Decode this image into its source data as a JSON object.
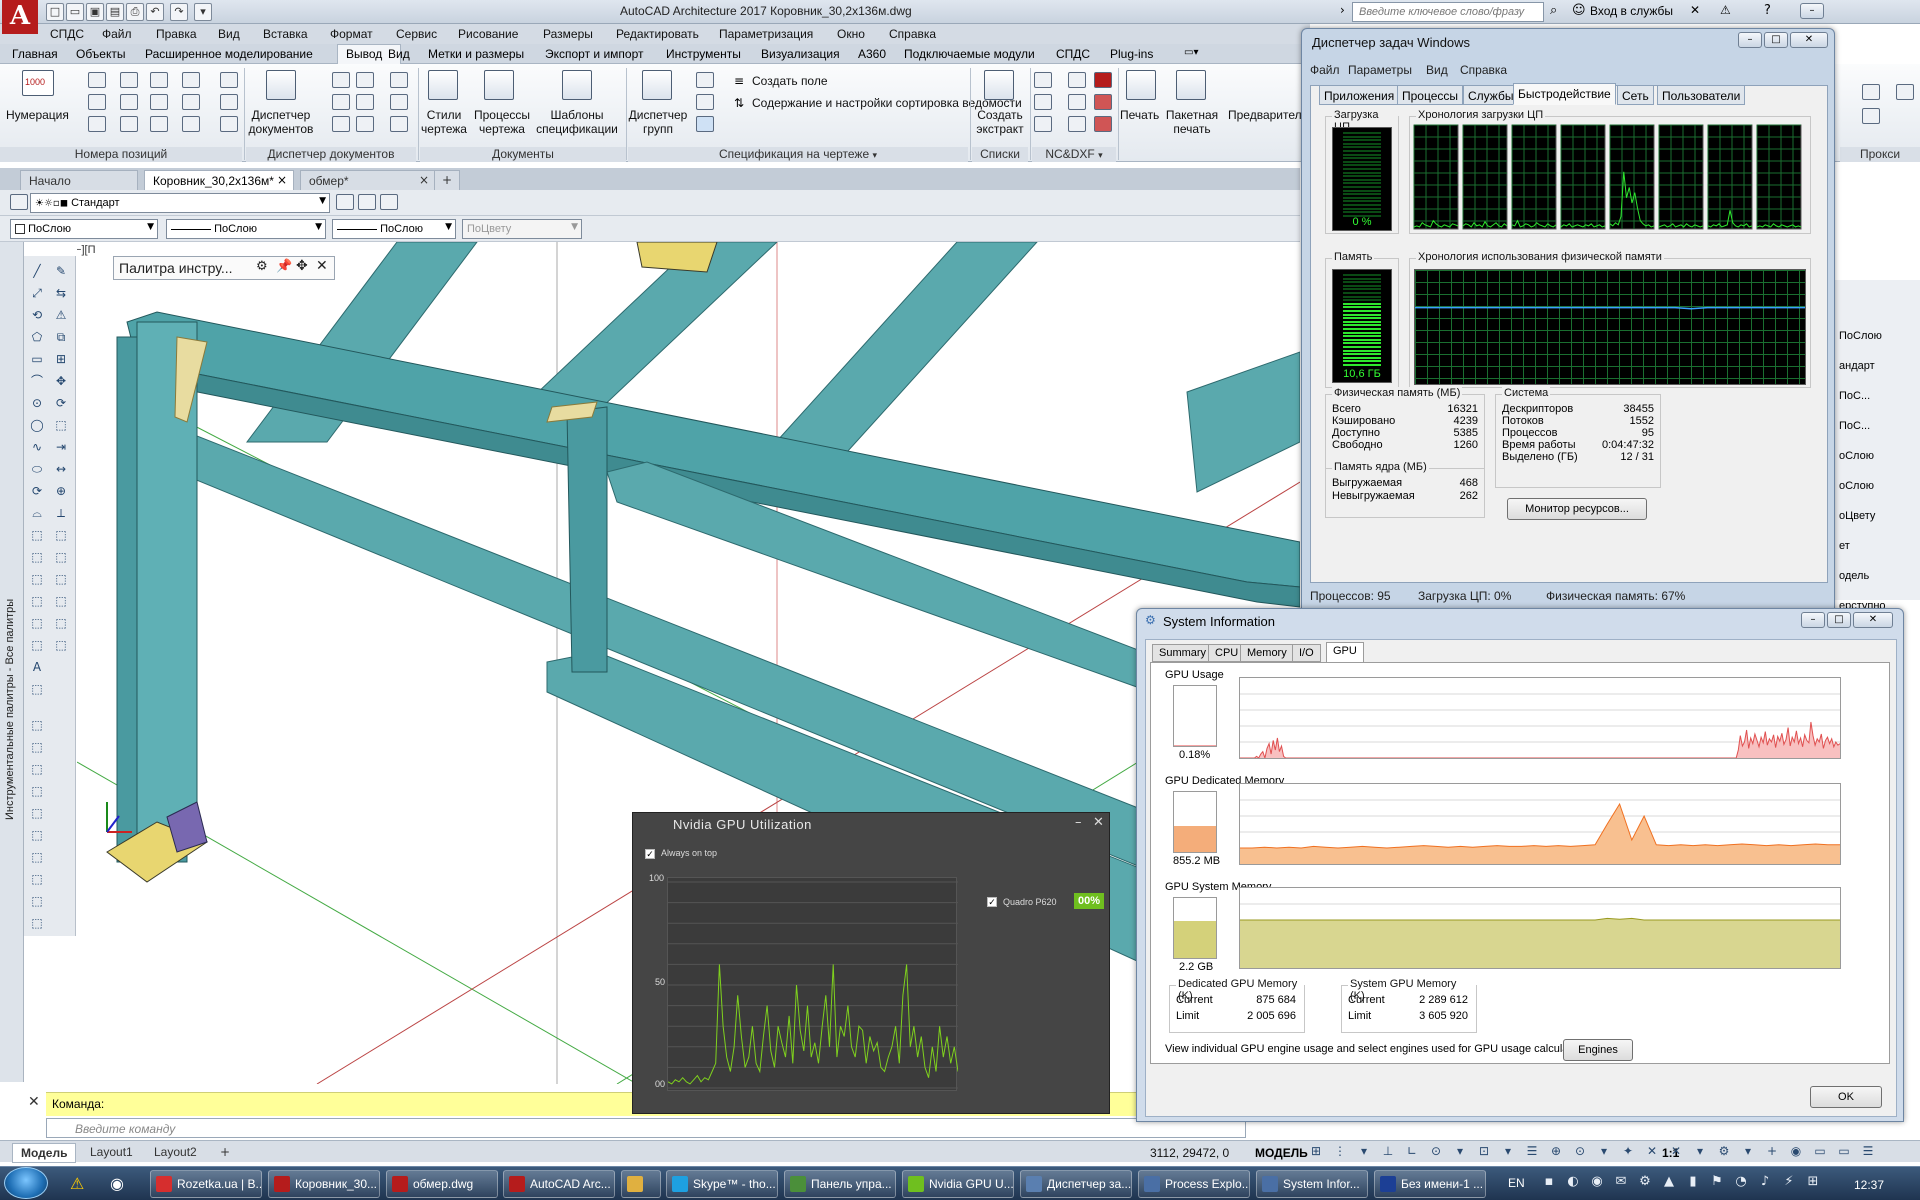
{
  "app": {
    "title": "AutoCAD Architecture 2017   Коровник_30,2х136м.dwg",
    "logo": "A",
    "search_placeholder": "Введите ключевое слово/фразу",
    "signin": "Вход в службы",
    "accent": "#b51c1c"
  },
  "menubar": [
    "СПДС",
    "Файл",
    "Правка",
    "Вид",
    "Вставка",
    "Формат",
    "Сервис",
    "Рисование",
    "Размеры",
    "Редактировать",
    "Параметризация",
    "Окно",
    "Справка"
  ],
  "ribbon_tabs": [
    "Главная",
    "Объекты",
    "Расширенное моделирование",
    "Вывод",
    "Вид",
    "Метки и размеры",
    "Экспорт и импорт",
    "Инструменты",
    "Визуализация",
    "A360",
    "Подключаемые модули",
    "СПДС",
    "Plug-ins"
  ],
  "ribbon": {
    "numbering": {
      "label": "Нумерация",
      "counter": "1000"
    },
    "doc_manager": "Диспетчер документов",
    "styles": "Стили чертежа",
    "processes": "Процессы чертежа",
    "templates": "Шаблоны спецификации",
    "group_manager": "Диспетчер групп",
    "create_field": "Создать поле",
    "content_settings": "Содержание и настройки сортировка ведомости",
    "create_extract": "Создать экстракт",
    "print": "Печать",
    "batch_print": "Пакетная печать",
    "preview": "Предварительный",
    "groups": {
      "positions": "Номера позиций",
      "docmgr": "Диспетчер документов",
      "documents": "Документы",
      "spec": "Спецификация на чертеже",
      "lists": "Списки",
      "ncdxf": "NC&DXF",
      "proxy": "Прокси"
    }
  },
  "doc_tabs": [
    "Начало",
    "Коровник_30,2х136м*",
    "обмер*"
  ],
  "toolbar": {
    "style": "Стандарт",
    "layer": "ПоСлою",
    "linetype": "ПоСлою",
    "lineweight": "ПоСлою",
    "color": "ПоЦвету"
  },
  "palette_tip": "Палитра инстру...",
  "palette_vertical": "Инструментальные палитры - Все палитры",
  "view_label": "[−][П",
  "command": {
    "history": "Команда:",
    "placeholder": "Введите команду"
  },
  "layout_tabs": [
    "Модель",
    "Layout1",
    "Layout2"
  ],
  "status": {
    "coords": "3112, 29472, 0",
    "space": "МОДЕЛЬ",
    "scale": "1:1"
  },
  "right_props": [
    "ПоСлою",
    "андарт",
    "ПоС...",
    "ПоС...",
    "оСлою",
    "оСлою",
    "оЦвету",
    "ет",
    "одель",
    "ерступно"
  ],
  "taskmgr": {
    "title": "Диспетчер задач Windows",
    "menu": [
      "Файл",
      "Параметры",
      "Вид",
      "Справка"
    ],
    "tabs": [
      "Приложения",
      "Процессы",
      "Службы",
      "Быстродействие",
      "Сеть",
      "Пользователи"
    ],
    "cpu_load_title": "Загрузка ЦП",
    "cpu_load_value": "0 %",
    "cpu_history_title": "Хронология загрузки ЦП",
    "memory_title": "Память",
    "memory_value": "10,6 ГБ",
    "mem_history_title": "Хронология использования физической памяти",
    "physmem_title": "Физическая память (МБ)",
    "physmem": [
      [
        "Всего",
        "16321"
      ],
      [
        "Кэшировано",
        "4239"
      ],
      [
        "Доступно",
        "5385"
      ],
      [
        "Свободно",
        "1260"
      ]
    ],
    "kernel_title": "Память ядра (МБ)",
    "kernel": [
      [
        "Выгружаемая",
        "468"
      ],
      [
        "Невыгружаемая",
        "262"
      ]
    ],
    "system_title": "Система",
    "system": [
      [
        "Дескрипторов",
        "38455"
      ],
      [
        "Потоков",
        "1552"
      ],
      [
        "Процессов",
        "95"
      ],
      [
        "Время работы",
        "0:04:47:32"
      ],
      [
        "Выделено (ГБ)",
        "12 / 31"
      ]
    ],
    "monitor_btn": "Монитор ресурсов...",
    "status": [
      "Процессов: 95",
      "Загрузка ЦП: 0%",
      "Физическая память: 67%"
    ],
    "cpu_series": [
      [
        2,
        3,
        2,
        6,
        4,
        3,
        2,
        8,
        5,
        3,
        2,
        4,
        3,
        2,
        5,
        4,
        3
      ],
      [
        3,
        5,
        4,
        2,
        6,
        3,
        4,
        2,
        7,
        3,
        2,
        4,
        6,
        3,
        2,
        5,
        3
      ],
      [
        4,
        3,
        8,
        2,
        3,
        5,
        4,
        2,
        3,
        6,
        4,
        3,
        2,
        5,
        3,
        2,
        4
      ],
      [
        2,
        4,
        3,
        5,
        2,
        3,
        4,
        3,
        2,
        4,
        3,
        5,
        2,
        3,
        4,
        2,
        3
      ],
      [
        5,
        3,
        6,
        4,
        12,
        55,
        30,
        40,
        25,
        35,
        20,
        8,
        5,
        3,
        4,
        2,
        3
      ],
      [
        2,
        3,
        4,
        2,
        3,
        5,
        2,
        3,
        4,
        2,
        5,
        3,
        2,
        4,
        3,
        2,
        3
      ],
      [
        3,
        2,
        4,
        3,
        5,
        2,
        3,
        4,
        18,
        6,
        3,
        2,
        4,
        3,
        5,
        2,
        3
      ],
      [
        2,
        3,
        2,
        4,
        3,
        2,
        5,
        3,
        2,
        4,
        3,
        2,
        3,
        4,
        2,
        3,
        2
      ]
    ],
    "mem_series": [
      67,
      67,
      67,
      67,
      67,
      67,
      67,
      67,
      67,
      67,
      67,
      67,
      67,
      67,
      67,
      67,
      67,
      66,
      67,
      67,
      67,
      67,
      67,
      67,
      67
    ]
  },
  "sysinfo": {
    "title": "System Information",
    "tabs": [
      "Summary",
      "CPU",
      "Memory",
      "I/O",
      "GPU"
    ],
    "gpu_usage_label": "GPU Usage",
    "gpu_usage_value": "0.18%",
    "gpu_usage_fraction": 0.002,
    "dedicated_label": "GPU Dedicated Memory",
    "dedicated_value": "855.2 MB",
    "dedicated_fraction": 0.43,
    "system_label": "GPU System Memory",
    "system_value": "2.2 GB",
    "system_fraction": 0.61,
    "ded_box_title": "Dedicated GPU Memory (K)",
    "ded_box": [
      [
        "Current",
        "875 684"
      ],
      [
        "Limit",
        "2 005 696"
      ]
    ],
    "sys_box_title": "System GPU Memory (K)",
    "sys_box": [
      [
        "Current",
        "2 289 612"
      ],
      [
        "Limit",
        "3 605 920"
      ]
    ],
    "engines_text": "View individual GPU engine usage and select engines used for GPU usage calculations:",
    "engines_btn": "Engines",
    "ok_btn": "OK",
    "usage_series": [
      0,
      0,
      0,
      0,
      0,
      0,
      0,
      0,
      2,
      0,
      5,
      8,
      0,
      12,
      18,
      5,
      22,
      10,
      25,
      8,
      15,
      2,
      0,
      0,
      0,
      0,
      0,
      0,
      0,
      0,
      0,
      0,
      0,
      0,
      0,
      0,
      0,
      0,
      0,
      0,
      0,
      0,
      0,
      0,
      0,
      0,
      0,
      0,
      0,
      0,
      0,
      0,
      0,
      0,
      0,
      0,
      0,
      0,
      0,
      0,
      0,
      0,
      0,
      0,
      0,
      0,
      0,
      0,
      0,
      0,
      0,
      0,
      0,
      0,
      0,
      0,
      0,
      0,
      0,
      0,
      0,
      0,
      0,
      0,
      0,
      0,
      0,
      0,
      0,
      0,
      0,
      0,
      0,
      0,
      0,
      0,
      0,
      0,
      0,
      0,
      0,
      0,
      0,
      0,
      0,
      0,
      0,
      0,
      0,
      0,
      0,
      0,
      0,
      0,
      0,
      0,
      0,
      0,
      0,
      0,
      0,
      0,
      0,
      0,
      0,
      0,
      0,
      0,
      0,
      0,
      0,
      0,
      0,
      0,
      0,
      0,
      0,
      0,
      0,
      0,
      0,
      0,
      0,
      0,
      0,
      0,
      0,
      0,
      0,
      0,
      0,
      0,
      0,
      0,
      0,
      0,
      0,
      0,
      0,
      0,
      0,
      0,
      0,
      0,
      0,
      0,
      0,
      0,
      0,
      0,
      0,
      0,
      0,
      0,
      0,
      0,
      0,
      0,
      0,
      0,
      0,
      0,
      0,
      0,
      0,
      0,
      0,
      0,
      0,
      0,
      0,
      0,
      0,
      0,
      0,
      0,
      0,
      0,
      0,
      0,
      0,
      0,
      0,
      0,
      0,
      0,
      0,
      0,
      0,
      0,
      0,
      0,
      0,
      0,
      0,
      0,
      0,
      0,
      0,
      0,
      0,
      0,
      0,
      0,
      0,
      0,
      0,
      0,
      0,
      0,
      0,
      0,
      0,
      0,
      0,
      0,
      0,
      0,
      0,
      0,
      0,
      0,
      0,
      0,
      0,
      0,
      0,
      0,
      0,
      0,
      0,
      0,
      0,
      0,
      0,
      0,
      0,
      0,
      0,
      0,
      0,
      0,
      0,
      0,
      0,
      0,
      0,
      0,
      0,
      0,
      0,
      0,
      0,
      0,
      0,
      0,
      0,
      0,
      0,
      0,
      0,
      0,
      0,
      0,
      0,
      0,
      0,
      0,
      0,
      0,
      0,
      0,
      0,
      0,
      0,
      0,
      0,
      0,
      0,
      0,
      0,
      0,
      0,
      0,
      0,
      0,
      0,
      0,
      0,
      0,
      0,
      0,
      0,
      0,
      0,
      0,
      0,
      0,
      0,
      0,
      0,
      0,
      0,
      0,
      0,
      0,
      0,
      0,
      0,
      0,
      0,
      0,
      0,
      0,
      0,
      0,
      0,
      0,
      0,
      0,
      0,
      0,
      0,
      0,
      0,
      0,
      0,
      0,
      0,
      0,
      0,
      0,
      0,
      0,
      0,
      0,
      0,
      0,
      0,
      0,
      0,
      0,
      0,
      0,
      0,
      0,
      0,
      0,
      0,
      0,
      0,
      0,
      0,
      0,
      0,
      0,
      0,
      0,
      0,
      0,
      0,
      0,
      0,
      0,
      0,
      0,
      0,
      0,
      0,
      0,
      0,
      0,
      0,
      0,
      0,
      0,
      0,
      0,
      0,
      0,
      0,
      0,
      0,
      0,
      0,
      0,
      0,
      0,
      0,
      0,
      0,
      0,
      0,
      0,
      0,
      0,
      0,
      0,
      0,
      0,
      0,
      0,
      0,
      0,
      0,
      0,
      0,
      0,
      0,
      0,
      0,
      0,
      0,
      0,
      0,
      0,
      0,
      0,
      0,
      0,
      0,
      0,
      0,
      0,
      0,
      0,
      0,
      0,
      0,
      0,
      0,
      0,
      0,
      0,
      0,
      0,
      0,
      0,
      0,
      0,
      0,
      0,
      0,
      0,
      0,
      0,
      0,
      0,
      0,
      0,
      0,
      0,
      0,
      0,
      0,
      0,
      0,
      0,
      0,
      0,
      0,
      0,
      0,
      0,
      0,
      0,
      0,
      0,
      0,
      0,
      0,
      0,
      0,
      0,
      0,
      0,
      0,
      0,
      0,
      0,
      0,
      0,
      0,
      0,
      0,
      0,
      0,
      0,
      0,
      0,
      0,
      0,
      0,
      0,
      0,
      0,
      0
    ],
    "usage_burst": [
      10,
      28,
      15,
      20,
      35,
      12,
      25,
      18,
      30,
      22,
      14,
      26,
      19,
      33,
      16,
      24,
      20,
      29,
      13,
      27,
      21,
      31,
      17,
      23,
      38,
      15,
      26,
      20,
      34,
      18,
      25,
      14,
      29,
      22,
      19,
      45,
      28,
      16,
      24,
      20,
      30,
      12,
      22,
      26,
      18,
      24,
      14,
      20,
      16,
      18
    ],
    "dedicated_series": [
      20,
      20,
      21,
      20,
      21,
      20,
      22,
      21,
      20,
      21,
      22,
      21,
      20,
      21,
      22,
      23,
      22,
      21,
      22,
      21,
      22,
      23,
      22,
      22,
      23,
      22,
      23,
      22,
      23,
      24,
      50,
      75,
      30,
      60,
      24,
      23,
      24,
      23,
      24,
      23,
      24,
      25,
      24,
      23,
      24,
      23,
      24,
      25,
      24,
      24
    ],
    "system_series": [
      60,
      60,
      60,
      60,
      60,
      60,
      60,
      60,
      60,
      60,
      60,
      60,
      60,
      60,
      60,
      60,
      60,
      60,
      60,
      60,
      60,
      60,
      60,
      60,
      60,
      60,
      60,
      60,
      60,
      60,
      62,
      61,
      62,
      60,
      60,
      60,
      60,
      60,
      60,
      60,
      60,
      60,
      60,
      60,
      60,
      60,
      60,
      60,
      60,
      60
    ]
  },
  "nvidia": {
    "title": "Nvidia GPU Utilization",
    "always_on_top": "Always on top",
    "device": "Quadro P620",
    "percent": "00%",
    "y_ticks": [
      "100",
      "50",
      "00"
    ],
    "series": [
      3,
      2,
      4,
      3,
      5,
      3,
      2,
      4,
      6,
      3,
      5,
      4,
      8,
      12,
      60,
      30,
      15,
      8,
      20,
      45,
      25,
      10,
      15,
      30,
      12,
      8,
      25,
      40,
      18,
      10,
      30,
      22,
      15,
      35,
      12,
      50,
      28,
      18,
      40,
      15,
      22,
      12,
      30,
      45,
      20,
      60,
      15,
      30,
      25,
      40,
      20,
      15,
      30,
      28,
      12,
      25,
      18,
      22,
      10,
      8,
      15,
      20,
      30,
      12,
      45,
      60,
      20,
      30,
      15,
      25,
      10,
      5,
      20,
      8,
      30,
      15,
      25,
      12,
      20,
      8
    ]
  },
  "taskbar": [
    {
      "label": "Rozetka.ua | B...",
      "color": "#d62e2e"
    },
    {
      "label": "Коровник_30...",
      "color": "#b51c1c"
    },
    {
      "label": "обмер.dwg",
      "color": "#b51c1c"
    },
    {
      "label": "AutoCAD Arc...",
      "color": "#b51c1c"
    },
    {
      "label": "",
      "color": "#e0b040"
    },
    {
      "label": "Skype™ - tho...",
      "color": "#1ea0e0"
    },
    {
      "label": "Панель упра...",
      "color": "#4b8f3a"
    },
    {
      "label": "Nvidia GPU U...",
      "color": "#6fbf1f"
    },
    {
      "label": "Диспетчер за...",
      "color": "#5a7fb0"
    },
    {
      "label": "Process Explo...",
      "color": "#4a6fa5"
    },
    {
      "label": "System Infor...",
      "color": "#4a6fa5"
    },
    {
      "label": "Без имени-1 ...",
      "color": "#1c3f95"
    }
  ],
  "tray": {
    "lang": "EN",
    "clock": "12:37"
  }
}
